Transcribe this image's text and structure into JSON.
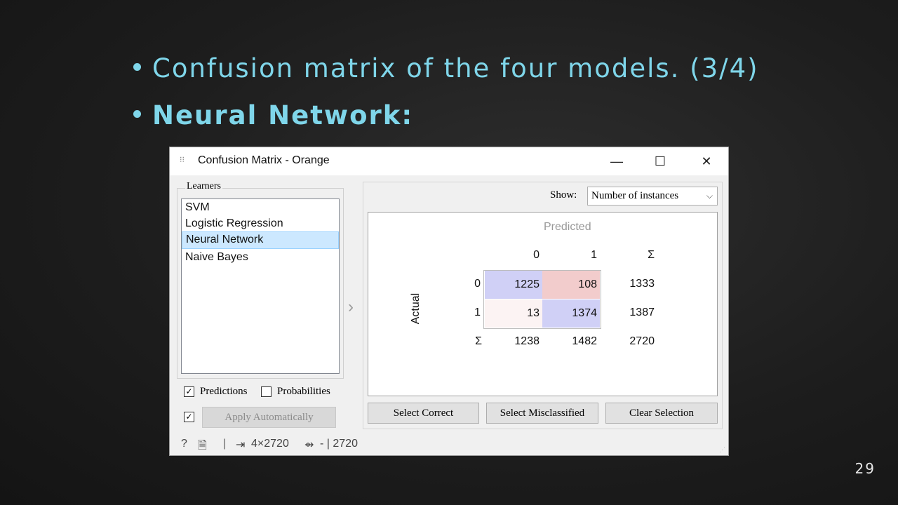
{
  "slide": {
    "bullet1": "Confusion matrix of the four models. (3/4)",
    "bullet2": "Neural Network:",
    "page_number": "29"
  },
  "window": {
    "title": "Confusion Matrix - Orange",
    "minimize": "—",
    "maximize": "☐",
    "close": "✕"
  },
  "learners": {
    "group_title": "Learners",
    "items": [
      "SVM",
      "Logistic Regression",
      "Neural Network",
      "Naive Bayes"
    ],
    "selected": "Neural Network"
  },
  "options": {
    "predictions_label": "Predictions",
    "predictions_checked": true,
    "probabilities_label": "Probabilities",
    "probabilities_checked": false,
    "apply_auto_checked": true,
    "apply_label": "Apply Automatically"
  },
  "show": {
    "label": "Show:",
    "value": "Number of instances"
  },
  "matrix": {
    "predicted_label": "Predicted",
    "actual_label": "Actual",
    "col_headers": [
      "0",
      "1",
      "Σ"
    ],
    "row_headers": [
      "0",
      "1",
      "Σ"
    ],
    "cells": [
      [
        "1225",
        "108"
      ],
      [
        "13",
        "1374"
      ]
    ],
    "row_sums": [
      "1333",
      "1387"
    ],
    "col_sums": [
      "1238",
      "1482"
    ],
    "total": "2720",
    "colors": {
      "correct": "#d0d0f6",
      "mis_strong": "#f2cccc",
      "mis_weak": "#fcf3f3"
    }
  },
  "buttons": {
    "select_correct": "Select Correct",
    "select_misclassified": "Select Misclassified",
    "clear_selection": "Clear Selection"
  },
  "status": {
    "input": "4×2720",
    "output": "- | 2720"
  }
}
